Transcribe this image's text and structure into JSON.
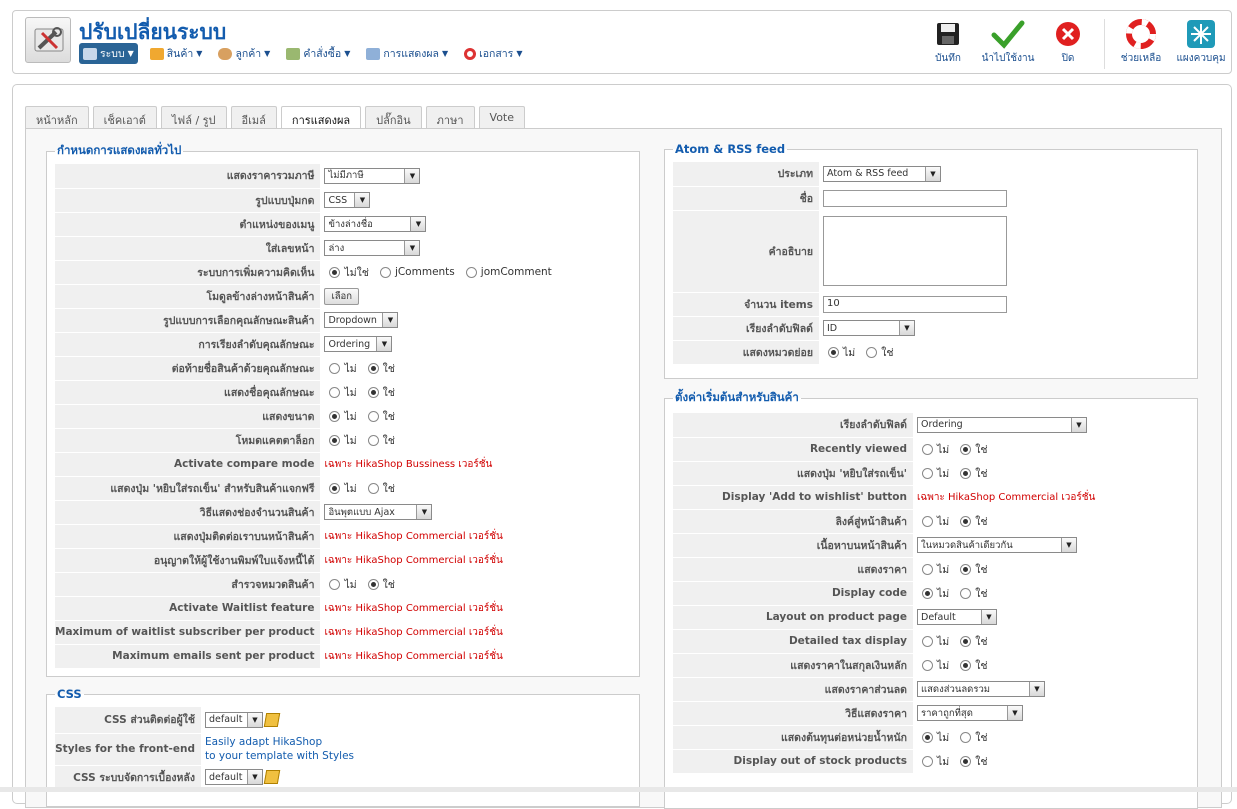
{
  "header": {
    "title": "ปรับเปลี่ยนระบบ",
    "menu": [
      {
        "label": "ระบบ",
        "icon": "wrench-icon",
        "active": true
      },
      {
        "label": "สินค้า",
        "icon": "box-icon"
      },
      {
        "label": "ลูกค้า",
        "icon": "users-icon"
      },
      {
        "label": "คำสั่งซื้อ",
        "icon": "orders-icon"
      },
      {
        "label": "การแสดงผล",
        "icon": "display-icon"
      },
      {
        "label": "เอกสาร",
        "icon": "help-ring-icon"
      }
    ],
    "tools": {
      "save": "บันทึก",
      "apply": "นำไปใช้งาน",
      "close": "ปิด",
      "help": "ช่วยเหลือ",
      "dashboard": "แผงควบคุม"
    }
  },
  "tabs": [
    "หน้าหลัก",
    "เช็คเอาต์",
    "ไฟล์ / รูป",
    "อีเมล์",
    "การแสดงผล",
    "ปลั๊กอิน",
    "ภาษา",
    "Vote"
  ],
  "active_tab": "การแสดงผล",
  "general": {
    "legend": "กำหนดการแสดงผลทั่วไป",
    "rows": [
      {
        "label": "แสดงราคารวมภาษี",
        "select": "ไม่มีภาษี"
      },
      {
        "label": "รูปแบบปุ่มกด",
        "select": "CSS"
      },
      {
        "label": "ตำแหน่งของเมนู",
        "select": "ข้างล่างชื่อ"
      },
      {
        "label": "ใส่เลขหน้า",
        "select": "ล่าง"
      },
      {
        "label": "ระบบการเพิ่มความคิดเห็น",
        "radios": [
          "ไม่ใช่",
          "jComments",
          "jomComment"
        ],
        "on": 0
      },
      {
        "label": "โมดูลข้างล่างหน้าสินค้า",
        "button": "เลือก"
      },
      {
        "label": "รูปแบบการเลือกคุณลักษณะสินค้า",
        "select": "Dropdown"
      },
      {
        "label": "การเรียงลำดับคุณลักษณะ",
        "select": "Ordering"
      },
      {
        "label": "ต่อท้ายชื่อสินค้าด้วยคุณลักษณะ",
        "radios": [
          "ไม่",
          "ใช่"
        ],
        "on": 1
      },
      {
        "label": "แสดงชื่อคุณลักษณะ",
        "radios": [
          "ไม่",
          "ใช่"
        ],
        "on": 1
      },
      {
        "label": "แสดงขนาด",
        "radios": [
          "ไม่",
          "ใช่"
        ],
        "on": 0
      },
      {
        "label": "โหมดแคตตาล็อก",
        "radios": [
          "ไม่",
          "ใช่"
        ],
        "on": 0
      },
      {
        "label": "Activate compare mode",
        "note": "เฉพาะ HikaShop Bussiness เวอร์ชั่น"
      },
      {
        "label": "แสดงปุ่ม 'หยิบใส่รถเข็น' สำหรับสินค้าแจกฟรี",
        "radios": [
          "ไม่",
          "ใช่"
        ],
        "on": 0
      },
      {
        "label": "วิธีแสดงช่องจำนวนสินค้า",
        "select": "อินพุตแบบ Ajax"
      },
      {
        "label": "แสดงปุ่มติดต่อเราบนหน้าสินค้า",
        "note": "เฉพาะ HikaShop Commercial เวอร์ชั่น"
      },
      {
        "label": "อนุญาตให้ผู้ใช้งานพิมพ์ใบแจ้งหนี้ได้",
        "note": "เฉพาะ HikaShop Commercial เวอร์ชั่น"
      },
      {
        "label": "สำรวจหมวดสินค้า",
        "radios": [
          "ไม่",
          "ใช่"
        ],
        "on": 1
      },
      {
        "label": "Activate Waitlist feature",
        "note": "เฉพาะ HikaShop Commercial เวอร์ชั่น"
      },
      {
        "label": "Maximum of waitlist subscriber per product",
        "note": "เฉพาะ HikaShop Commercial เวอร์ชั่น"
      },
      {
        "label": "Maximum emails sent per product",
        "note": "เฉพาะ HikaShop Commercial เวอร์ชั่น"
      }
    ]
  },
  "css": {
    "legend": "CSS",
    "rows": [
      {
        "label": "CSS ส่วนติดต่อผู้ใช้",
        "select": "default"
      },
      {
        "label": "Styles for the front-end",
        "link1": "Easily adapt HikaShop",
        "link2": "to your template with Styles"
      },
      {
        "label": "CSS ระบบจัดการเบื้องหลัง",
        "select": "default"
      }
    ]
  },
  "feed": {
    "legend": "Atom & RSS feed",
    "type_label": "ประเภท",
    "type_value": "Atom & RSS feed",
    "name_label": "ชื่อ",
    "name_value": "",
    "desc_label": "คำอธิบาย",
    "items_label": "จำนวน items",
    "items_value": "10",
    "order_label": "เรียงลำดับฟิลด์",
    "order_value": "ID",
    "sub_label": "แสดงหมวดย่อย",
    "sub_radios": [
      "ไม่",
      "ใช่"
    ],
    "sub_on": 0
  },
  "product": {
    "legend": "ตั้งค่าเริ่มต้นสำหรับสินค้า",
    "rows": [
      {
        "label": "เรียงลำดับฟิลด์",
        "select": "Ordering"
      },
      {
        "label": "Recently viewed",
        "radios": [
          "ไม่",
          "ใช่"
        ],
        "on": 1
      },
      {
        "label": "แสดงปุ่ม 'หยิบใส่รถเข็น'",
        "radios": [
          "ไม่",
          "ใช่"
        ],
        "on": 1
      },
      {
        "label": "Display 'Add to wishlist' button",
        "note": "เฉพาะ HikaShop Commercial เวอร์ชั่น"
      },
      {
        "label": "ลิงค์สู่หน้าสินค้า",
        "radios": [
          "ไม่",
          "ใช่"
        ],
        "on": 1
      },
      {
        "label": "เนื้อหาบนหน้าสินค้า",
        "select": "ในหมวดสินค้าเดียวกัน"
      },
      {
        "label": "แสดงราคา",
        "radios": [
          "ไม่",
          "ใช่"
        ],
        "on": 1
      },
      {
        "label": "Display code",
        "radios": [
          "ไม่",
          "ใช่"
        ],
        "on": 0
      },
      {
        "label": "Layout on product page",
        "select": "Default"
      },
      {
        "label": "Detailed tax display",
        "radios": [
          "ไม่",
          "ใช่"
        ],
        "on": 1
      },
      {
        "label": "แสดงราคาในสกุลเงินหลัก",
        "radios": [
          "ไม่",
          "ใช่"
        ],
        "on": 1
      },
      {
        "label": "แสดงราคาส่วนลด",
        "select": "แสดงส่วนลดรวม"
      },
      {
        "label": "วิธีแสดงราคา",
        "select": "ราคาถูกที่สุด"
      },
      {
        "label": "แสดงต้นทุนต่อหน่วยน้ำหนัก",
        "radios": [
          "ไม่",
          "ใช่"
        ],
        "on": 0
      },
      {
        "label": "Display out of stock products",
        "radios": [
          "ไม่",
          "ใช่"
        ],
        "on": 1
      }
    ]
  }
}
